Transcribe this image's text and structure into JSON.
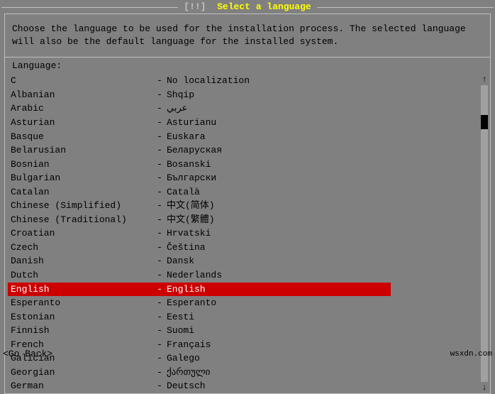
{
  "title": {
    "brackets": "[!!]",
    "text": "Select a language"
  },
  "description": "Choose the language to be used for the installation process. The selected language will also be the default language for the installed system.",
  "language_label": "Language:",
  "languages": [
    {
      "name": "C",
      "dash": "-",
      "native": "No localization"
    },
    {
      "name": "Albanian",
      "dash": "-",
      "native": "Shqip"
    },
    {
      "name": "Arabic",
      "dash": "-",
      "native": "عربي"
    },
    {
      "name": "Asturian",
      "dash": "-",
      "native": "Asturianu"
    },
    {
      "name": "Basque",
      "dash": "-",
      "native": "Euskara"
    },
    {
      "name": "Belarusian",
      "dash": "-",
      "native": "Беларуская"
    },
    {
      "name": "Bosnian",
      "dash": "-",
      "native": "Bosanski"
    },
    {
      "name": "Bulgarian",
      "dash": "-",
      "native": "Български"
    },
    {
      "name": "Catalan",
      "dash": "-",
      "native": "Català"
    },
    {
      "name": "Chinese (Simplified)",
      "dash": "-",
      "native": "中文(简体)"
    },
    {
      "name": "Chinese (Traditional)",
      "dash": "-",
      "native": "中文(繁體)"
    },
    {
      "name": "Croatian",
      "dash": "-",
      "native": "Hrvatski"
    },
    {
      "name": "Czech",
      "dash": "-",
      "native": "Čeština"
    },
    {
      "name": "Danish",
      "dash": "-",
      "native": "Dansk"
    },
    {
      "name": "Dutch",
      "dash": "-",
      "native": "Nederlands"
    },
    {
      "name": "English",
      "dash": "-",
      "native": "English",
      "selected": true
    },
    {
      "name": "Esperanto",
      "dash": "-",
      "native": "Esperanto"
    },
    {
      "name": "Estonian",
      "dash": "-",
      "native": "Eesti"
    },
    {
      "name": "Finnish",
      "dash": "-",
      "native": "Suomi"
    },
    {
      "name": "French",
      "dash": "-",
      "native": "Français"
    },
    {
      "name": "Galician",
      "dash": "-",
      "native": "Galego"
    },
    {
      "name": "Georgian",
      "dash": "-",
      "native": "ქართული"
    },
    {
      "name": "German",
      "dash": "-",
      "native": "Deutsch"
    }
  ],
  "footer": {
    "go_back": "<Go Back>",
    "watermark": "wsxdn.com"
  },
  "scrollbar": {
    "up_arrow": "↑",
    "down_arrow": "↓"
  }
}
